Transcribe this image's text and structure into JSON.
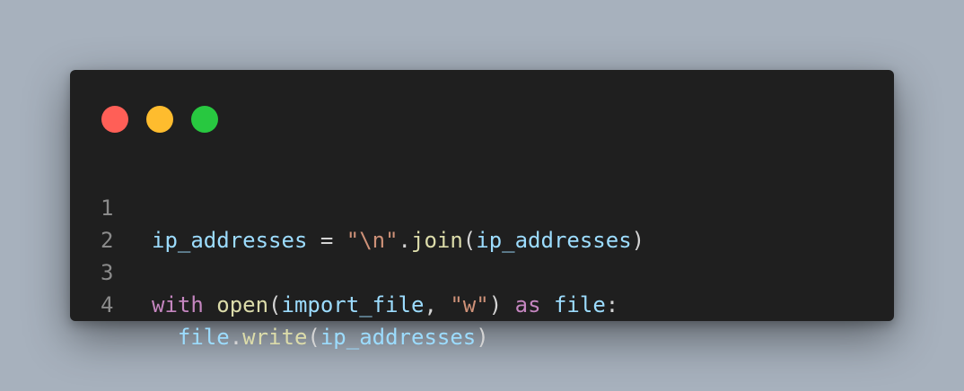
{
  "window": {
    "controls": [
      {
        "name": "close",
        "color": "#ff5f57"
      },
      {
        "name": "minimize",
        "color": "#febc2e"
      },
      {
        "name": "maximize",
        "color": "#28c840"
      }
    ]
  },
  "code": {
    "lines": [
      {
        "number": "1",
        "tokens": [
          {
            "text": "ip_addresses",
            "kind": "var"
          },
          {
            "text": " = ",
            "kind": "op"
          },
          {
            "text": "\"\\n\"",
            "kind": "str"
          },
          {
            "text": ".",
            "kind": "punc"
          },
          {
            "text": "join",
            "kind": "fn"
          },
          {
            "text": "(",
            "kind": "punc"
          },
          {
            "text": "ip_addresses",
            "kind": "var"
          },
          {
            "text": ")",
            "kind": "punc"
          }
        ]
      },
      {
        "number": "2",
        "tokens": []
      },
      {
        "number": "3",
        "tokens": [
          {
            "text": "with",
            "kind": "kw"
          },
          {
            "text": " ",
            "kind": "punc"
          },
          {
            "text": "open",
            "kind": "fn"
          },
          {
            "text": "(",
            "kind": "punc"
          },
          {
            "text": "import_file",
            "kind": "var"
          },
          {
            "text": ", ",
            "kind": "punc"
          },
          {
            "text": "\"w\"",
            "kind": "str"
          },
          {
            "text": ") ",
            "kind": "punc"
          },
          {
            "text": "as",
            "kind": "kw"
          },
          {
            "text": " ",
            "kind": "punc"
          },
          {
            "text": "file",
            "kind": "var"
          },
          {
            "text": ":",
            "kind": "punc"
          }
        ]
      },
      {
        "number": "4",
        "tokens": [
          {
            "text": "  ",
            "kind": "punc"
          },
          {
            "text": "file",
            "kind": "var"
          },
          {
            "text": ".",
            "kind": "punc"
          },
          {
            "text": "write",
            "kind": "fn"
          },
          {
            "text": "(",
            "kind": "punc"
          },
          {
            "text": "ip_addresses",
            "kind": "var"
          },
          {
            "text": ")",
            "kind": "punc"
          }
        ]
      }
    ]
  }
}
